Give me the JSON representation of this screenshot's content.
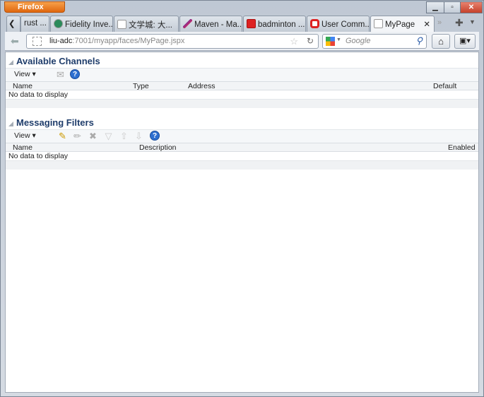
{
  "browser": {
    "app_button": "Firefox",
    "tabs": [
      {
        "label": "rust ..."
      },
      {
        "label": "Fidelity Inve..."
      },
      {
        "label": "文学城: 大..."
      },
      {
        "label": "Maven - Ma..."
      },
      {
        "label": "badminton ..."
      },
      {
        "label": "User Comm..."
      },
      {
        "label": "MyPage",
        "active": true
      }
    ],
    "url_host": "liu-adc",
    "url_rest": ":7001/myapp/faces/MyPage.jspx",
    "search_placeholder": "Google"
  },
  "sections": [
    {
      "title": "Available Channels",
      "view_label": "View ▾",
      "columns": [
        "Name",
        "Type",
        "Address",
        "Default"
      ],
      "empty_text": "No data to display"
    },
    {
      "title": "Messaging Filters",
      "view_label": "View ▾",
      "columns": [
        "Name",
        "Description",
        "Enabled"
      ],
      "empty_text": "No data to display"
    }
  ]
}
